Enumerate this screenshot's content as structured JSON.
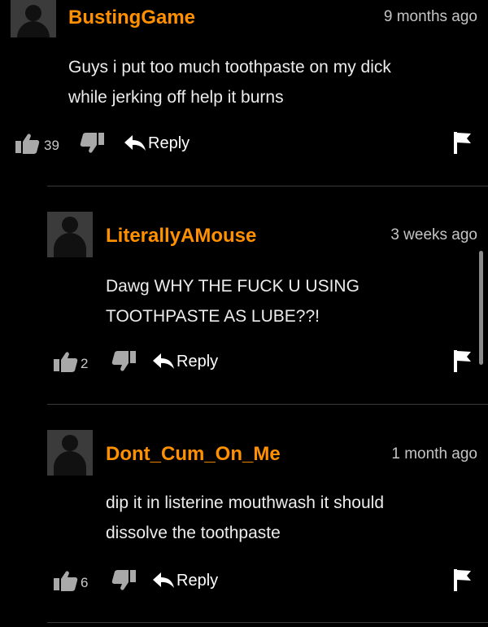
{
  "comments": [
    {
      "username": "BustingGame",
      "timestamp": "9 months ago",
      "text_lines": [
        "Guys i put too much toothpaste on my dick",
        "while jerking off help it burns"
      ],
      "likes": "39",
      "reply_label": "Reply"
    },
    {
      "username": "LiterallyAMouse",
      "timestamp": "3 weeks ago",
      "text_lines": [
        "Dawg WHY THE FUCK U USING",
        "TOOTHPASTE AS LUBE??!"
      ],
      "likes": "2",
      "reply_label": "Reply"
    },
    {
      "username": "Dont_Cum_On_Me",
      "timestamp": "1 month ago",
      "text_lines": [
        "dip it in listerine mouthwash it should",
        "dissolve the toothpaste"
      ],
      "likes": "6",
      "reply_label": "Reply"
    }
  ],
  "icons": {
    "thumbs_up": "thumbs-up-icon",
    "thumbs_down": "thumbs-down-icon",
    "reply": "reply-arrow-icon",
    "flag": "flag-icon"
  },
  "colors": {
    "background": "#000000",
    "username": "#ff9000",
    "text": "#ececec",
    "meta": "#c4c4c4",
    "icon_grey": "#a9a9a9"
  }
}
